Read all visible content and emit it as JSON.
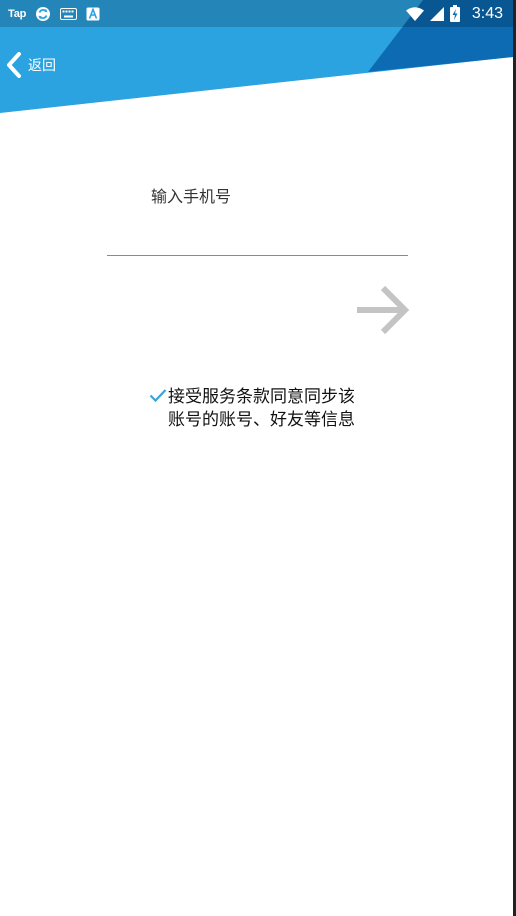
{
  "status_bar": {
    "app_label": "Tap",
    "time": "3:43",
    "icons": [
      "sync-icon",
      "keyboard-icon",
      "font-a-icon",
      "wifi-icon",
      "signal-icon",
      "battery-charging-icon"
    ]
  },
  "header": {
    "back_label": "返回",
    "colors": {
      "primary": "#2ba3e1",
      "accent": "#0c6bb3"
    }
  },
  "form": {
    "phone_label": "输入手机号",
    "phone_value": "",
    "phone_placeholder": "",
    "next_icon": "arrow-right-icon",
    "agreement_text": "接受服务条款同意同步该账号的账号、好友等信息",
    "agreement_checked": true
  },
  "colors": {
    "input_underline": "#3aa3d9",
    "check": "#3aa3d9",
    "next_arrow": "#c4c4c4"
  }
}
